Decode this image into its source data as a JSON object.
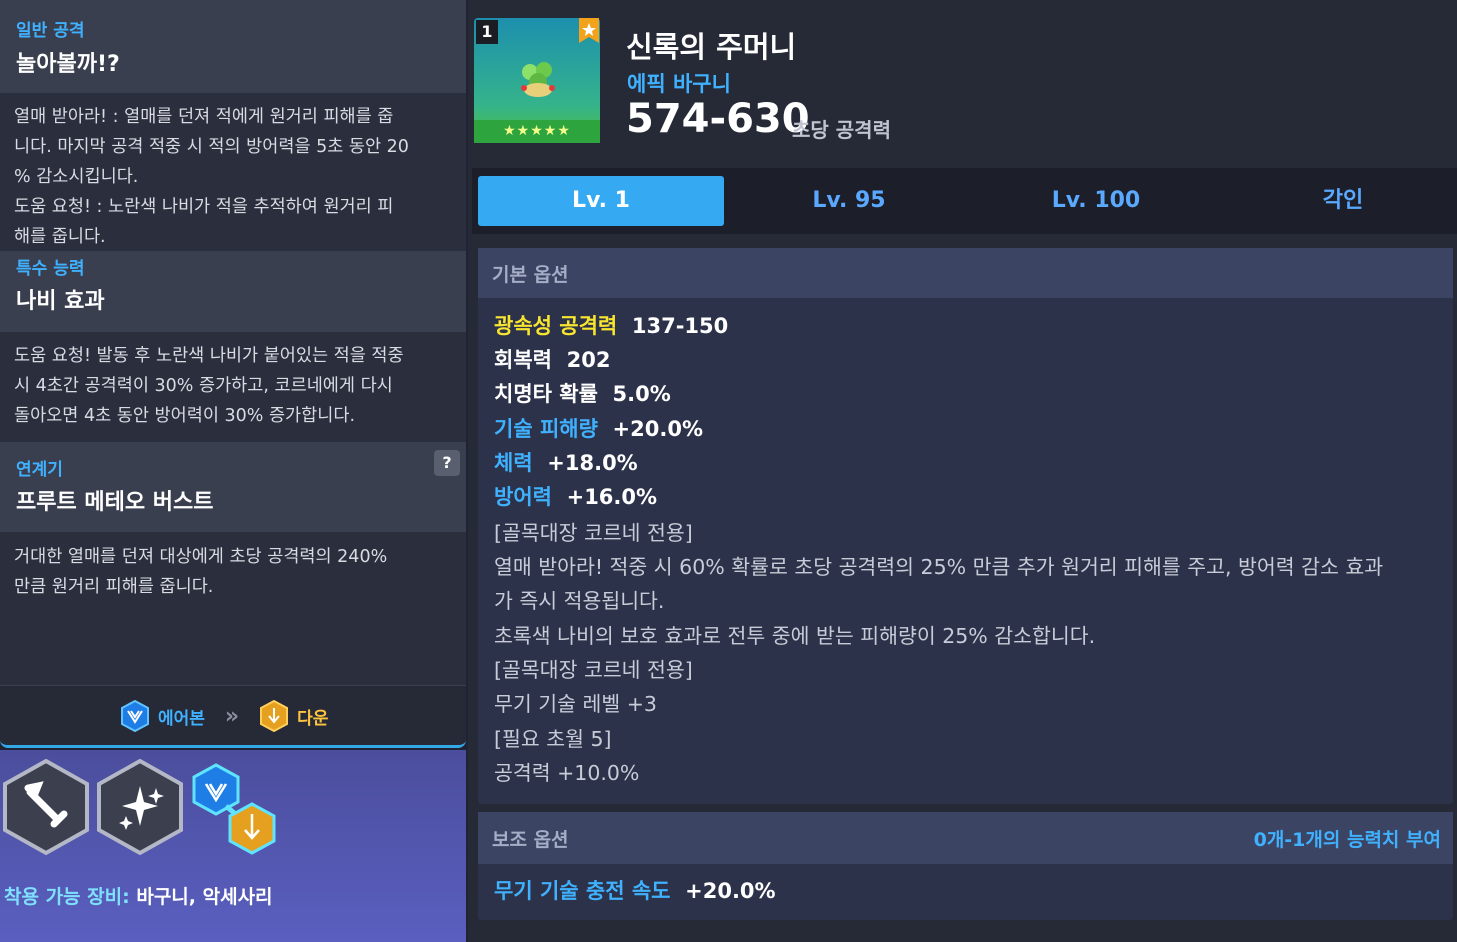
{
  "skills": {
    "normal": {
      "label": "일반 공격",
      "title": "놀아볼까!?",
      "desc": [
        "열매 받아라! : 열매를 던져 적에게 원거리 피해를 줍",
        "니다. 마지막 공격 적중 시 적의 방어력을 5초 동안 20",
        "% 감소시킵니다.",
        "도움 요청! : 노란색 나비가 적을 추적하여 원거리 피",
        "해를 줍니다."
      ]
    },
    "special": {
      "label": "특수 능력",
      "title": "나비 효과",
      "desc": [
        "도움 요청! 발동 후 노란색 나비가 붙어있는 적을 적중",
        "시 4초간 공격력이 30% 증가하고, 코르네에게 다시",
        "돌아오면 4초 동안 방어력이 30% 증가합니다."
      ]
    },
    "chain": {
      "label": "연계기",
      "help": "?",
      "title": "프루트 메테오 버스트",
      "desc": [
        "거대한 열매를 던져 대상에게 초당 공격력의 240%",
        "만큼 원거리 피해를 줍니다."
      ]
    }
  },
  "chain_flow": {
    "from": "에어본",
    "arrow": "»",
    "to": "다운"
  },
  "equip": {
    "label": "착용 가능 장비:",
    "value": " 바구니, 악세사리"
  },
  "item": {
    "slot_number": "1",
    "stars": "★★★★★",
    "name": "신록의 주머니",
    "type": "에픽 바구니",
    "attack": "574-630",
    "attack_label": "초당 공격력"
  },
  "tabs": [
    {
      "label": "Lv. 1",
      "active": true
    },
    {
      "label": "Lv. 95",
      "active": false
    },
    {
      "label": "Lv. 100",
      "active": false
    },
    {
      "label": "각인",
      "active": false
    }
  ],
  "basic_options": {
    "header": "기본 옵션",
    "stats": [
      {
        "key": "광속성 공격력",
        "value": "137-150",
        "color": "#f7e530"
      },
      {
        "key": "회복력",
        "value": "202",
        "color": "#ffffff"
      },
      {
        "key": "치명타 확률",
        "value": "5.0%",
        "color": "#ffffff"
      },
      {
        "key": "기술 피해량",
        "value": "+20.0%",
        "color": "#3fb1ff"
      },
      {
        "key": "체력",
        "value": "+18.0%",
        "color": "#3fb1ff"
      },
      {
        "key": "방어력",
        "value": "+16.0%",
        "color": "#3fb1ff"
      }
    ],
    "lines": [
      "[골목대장 코르네 전용]",
      "열매 받아라! 적중 시 60% 확률로 초당 공격력의 25% 만큼 추가 원거리 피해를 주고, 방어력 감소 효과",
      "가 즉시 적용됩니다.",
      "초록색 나비의 보호 효과로 전투 중에 받는 피해량이 25% 감소합니다.",
      "[골목대장 코르네 전용]",
      "무기 기술 레벨 +3",
      "[필요 초월 5]",
      "공격력 +10.0%"
    ]
  },
  "sub_options": {
    "header": "보조 옵션",
    "note": "0개-1개의 능력치 부여",
    "stat": {
      "key": "무기 기술 충전 속도",
      "value": "+20.0%"
    }
  }
}
